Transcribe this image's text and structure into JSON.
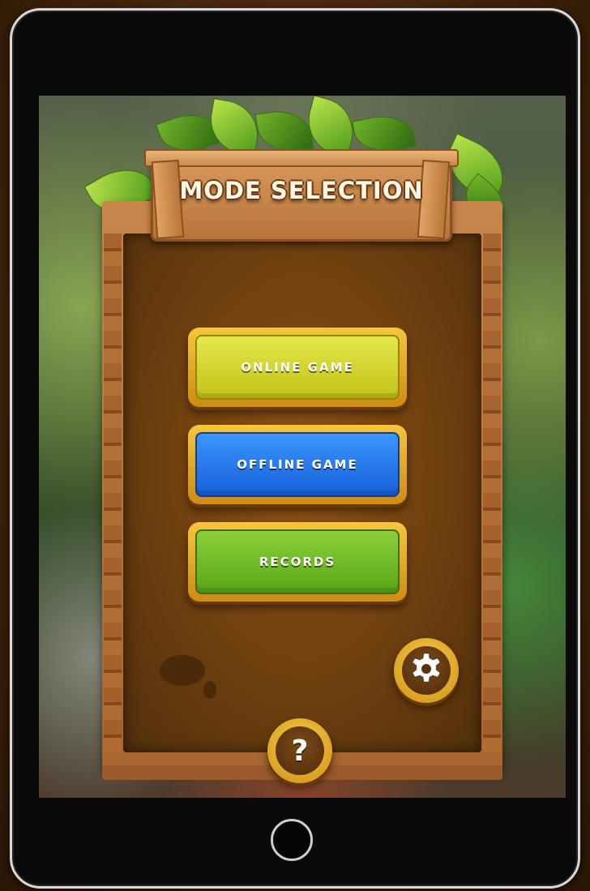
{
  "screen": {
    "title": "MODE SELECTION"
  },
  "menu": {
    "online_label": "ONLINE GAME",
    "offline_label": "OFFLINE GAME",
    "records_label": "RECORDS"
  },
  "controls": {
    "help_label": "?",
    "settings_icon": "gear-icon"
  },
  "colors": {
    "online_button": "#d3d52c",
    "offline_button": "#2a7be8",
    "records_button": "#72bb25",
    "button_rim": "#f0b92f",
    "wood": "#b8733a"
  }
}
